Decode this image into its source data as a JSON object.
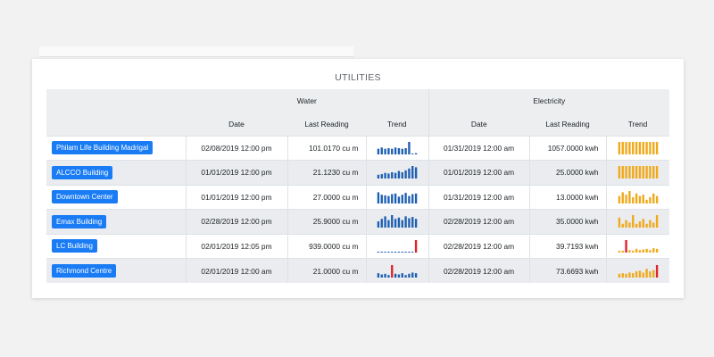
{
  "title": "UTILITIES",
  "groups": {
    "water": "Water",
    "electricity": "Electricity"
  },
  "columns": {
    "w_date": "Date",
    "w_reading": "Last Reading",
    "w_trend": "Trend",
    "e_date": "Date",
    "e_reading": "Last Reading",
    "e_trend": "Trend"
  },
  "colors": {
    "water_bar": "#1f5fb3",
    "electricity_bar": "#f0a91a",
    "alert_bar": "#e0222b"
  },
  "rows": [
    {
      "building": "Philam Life Building Madrigal",
      "water_date": "02/08/2019 12:00 pm",
      "water_reading": "101.0170 cu m",
      "electricity_date": "01/31/2019 12:00 am",
      "electricity_reading": "1057.0000 kwh",
      "water_trend": [
        0.45,
        0.55,
        0.45,
        0.5,
        0.45,
        0.55,
        0.5,
        0.45,
        0.5,
        1.0,
        0.0,
        0.1
      ],
      "water_alert": [],
      "electricity_trend": [
        1,
        1,
        1,
        1,
        1,
        1,
        1,
        1,
        1,
        1,
        1,
        1
      ],
      "electricity_alert": []
    },
    {
      "building": "ALCCO Building",
      "water_date": "01/01/2019 12:00 pm",
      "water_reading": "21.1230 cu m",
      "electricity_date": "01/01/2019 12:00 am",
      "electricity_reading": "25.0000 kwh",
      "water_trend": [
        0.3,
        0.35,
        0.45,
        0.4,
        0.5,
        0.45,
        0.6,
        0.5,
        0.65,
        0.8,
        1.0,
        0.9
      ],
      "water_alert": [],
      "electricity_trend": [
        1,
        1,
        1,
        1,
        1,
        1,
        1,
        1,
        1,
        1,
        1,
        1
      ],
      "electricity_alert": []
    },
    {
      "building": "Downtown Center",
      "water_date": "01/01/2019 12:00 pm",
      "water_reading": "27.0000 cu m",
      "electricity_date": "01/31/2019 12:00 am",
      "electricity_reading": "13.0000 kwh",
      "water_trend": [
        0.9,
        0.7,
        0.65,
        0.6,
        0.75,
        0.8,
        0.55,
        0.7,
        0.85,
        0.6,
        0.75,
        0.8
      ],
      "water_alert": [],
      "electricity_trend": [
        0.6,
        0.9,
        0.7,
        1.0,
        0.5,
        0.8,
        0.6,
        0.7,
        0.3,
        0.5,
        0.8,
        0.6
      ],
      "electricity_alert": []
    },
    {
      "building": "Emax Building",
      "water_date": "02/28/2019 12:00 pm",
      "water_reading": "25.9000 cu m",
      "electricity_date": "02/28/2019 12:00 am",
      "electricity_reading": "35.0000 kwh",
      "water_trend": [
        0.5,
        0.7,
        0.9,
        0.6,
        1.0,
        0.7,
        0.8,
        0.6,
        0.9,
        0.75,
        0.85,
        0.7
      ],
      "water_alert": [],
      "electricity_trend": [
        0.8,
        0.3,
        0.6,
        0.4,
        1.0,
        0.3,
        0.5,
        0.7,
        0.3,
        0.6,
        0.4,
        1.0
      ],
      "electricity_alert": []
    },
    {
      "building": "LC Building",
      "water_date": "02/01/2019 12:05 pm",
      "water_reading": "939.0000 cu m",
      "electricity_date": "02/28/2019 12:00 am",
      "electricity_reading": "39.7193 kwh",
      "water_trend": [
        0.03,
        0.03,
        0.03,
        0.05,
        0.03,
        0.03,
        0.03,
        0.05,
        0.03,
        0.03,
        0.05,
        1.0
      ],
      "water_alert": [
        11
      ],
      "electricity_trend": [
        0.15,
        0.15,
        1.0,
        0.2,
        0.15,
        0.3,
        0.2,
        0.25,
        0.3,
        0.2,
        0.35,
        0.3
      ],
      "electricity_alert": [
        2
      ]
    },
    {
      "building": "Richmond Centre",
      "water_date": "02/01/2019 12:00 am",
      "water_reading": "21.0000 cu m",
      "electricity_date": "02/28/2019 12:00 am",
      "electricity_reading": "73.6693 kwh",
      "water_trend": [
        0.35,
        0.25,
        0.3,
        0.2,
        1.0,
        0.3,
        0.25,
        0.35,
        0.2,
        0.3,
        0.4,
        0.35
      ],
      "water_alert": [
        4
      ],
      "electricity_trend": [
        0.3,
        0.35,
        0.3,
        0.4,
        0.35,
        0.5,
        0.55,
        0.4,
        0.7,
        0.5,
        0.6,
        1.0
      ],
      "electricity_alert": [
        11
      ]
    }
  ]
}
